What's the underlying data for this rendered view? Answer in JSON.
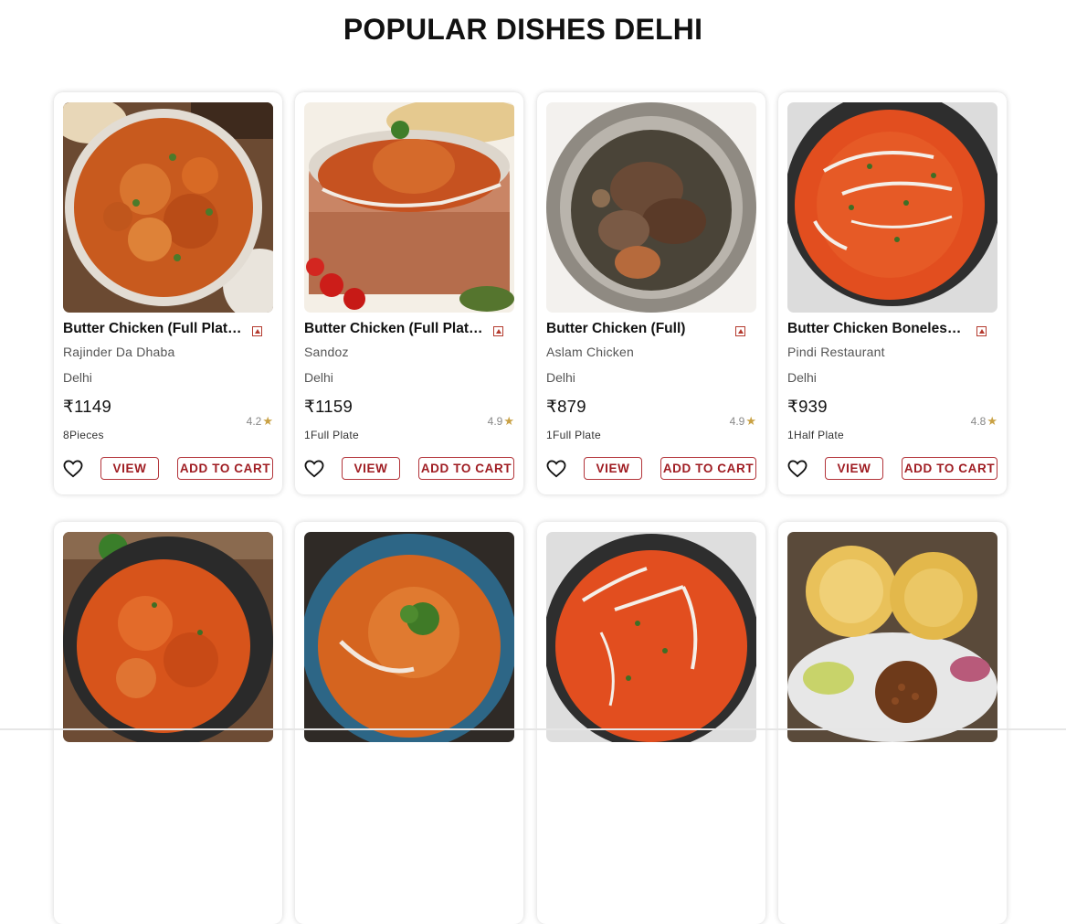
{
  "page": {
    "title": "POPULAR DISHES DELHI"
  },
  "buttons": {
    "view_label": "VIEW",
    "cart_label": "ADD TO CART"
  },
  "colors": {
    "accent": "#9f1c22",
    "rating_star": "#c9a144"
  },
  "dishes": [
    {
      "name": "Butter Chicken (Full Plate ...",
      "restaurant": "Rajinder Da Dhaba",
      "city": "Delhi",
      "price": "₹1149",
      "rating": "4.2",
      "qty": "8Pieces"
    },
    {
      "name": "Butter Chicken (Full Plate ...",
      "restaurant": "Sandoz",
      "city": "Delhi",
      "price": "₹1159",
      "rating": "4.9",
      "qty": "1Full Plate"
    },
    {
      "name": "Butter Chicken (Full)",
      "restaurant": "Aslam Chicken",
      "city": "Delhi",
      "price": "₹879",
      "rating": "4.9",
      "qty": "1Full Plate"
    },
    {
      "name": "Butter Chicken Boneless (...",
      "restaurant": "Pindi Restaurant",
      "city": "Delhi",
      "price": "₹939",
      "rating": "4.8",
      "qty": "1Half Plate"
    },
    {
      "name": "",
      "restaurant": "",
      "city": "",
      "price": "",
      "rating": "",
      "qty": ""
    },
    {
      "name": "",
      "restaurant": "",
      "city": "",
      "price": "",
      "rating": "",
      "qty": ""
    },
    {
      "name": "",
      "restaurant": "",
      "city": "",
      "price": "",
      "rating": "",
      "qty": ""
    },
    {
      "name": "",
      "restaurant": "",
      "city": "",
      "price": "",
      "rating": "",
      "qty": ""
    }
  ]
}
